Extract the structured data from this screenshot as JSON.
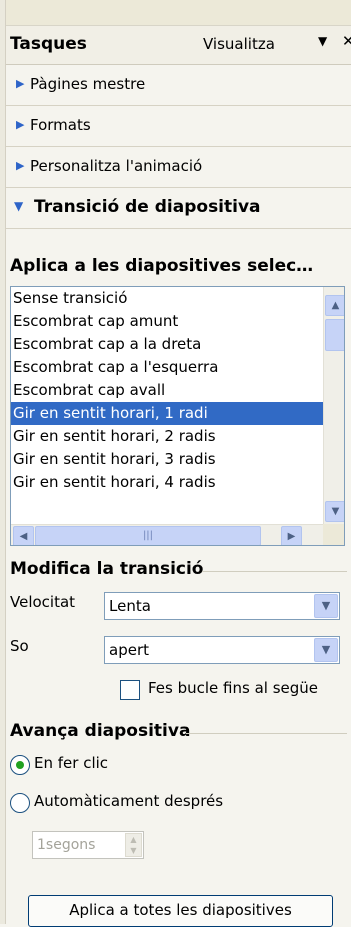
{
  "header": {
    "title": "Tasques",
    "view_label": "Visualitza",
    "dropdown_glyph": "▼",
    "close_glyph": "✕"
  },
  "sections": [
    {
      "label": "Pàgines mestre",
      "expanded": false,
      "icon": "triangle-right-icon"
    },
    {
      "label": "Formats",
      "expanded": false,
      "icon": "triangle-right-icon"
    },
    {
      "label": "Personalitza l'animació",
      "expanded": false,
      "icon": "triangle-right-icon"
    },
    {
      "label": "Transició de diapositiva",
      "expanded": true,
      "icon": "triangle-down-icon"
    }
  ],
  "transition": {
    "apply_to_label": "Aplica a les diapositives selec…",
    "items": [
      "Sense transició",
      "Escombrat cap amunt",
      "Escombrat cap a la dreta",
      "Escombrat cap a l'esquerra",
      "Escombrat cap avall",
      "Gir en sentit horari, 1 radi",
      "Gir en sentit horari, 2 radis",
      "Gir en sentit horari, 3 radis",
      "Gir en sentit horari, 4 radis"
    ],
    "selected_index": 5,
    "modify_label": "Modifica la transició",
    "speed_label": "Velocitat",
    "speed_value": "Lenta",
    "sound_label": "So",
    "sound_value": "apert",
    "loop_label": "Fes bucle fins al següe",
    "loop_checked": false
  },
  "advance": {
    "label": "Avança diapositiva",
    "on_click_label": "En fer clic",
    "on_click_selected": true,
    "auto_label": "Automàticament després",
    "auto_selected": false,
    "seconds_value": "1segons"
  },
  "apply_all_label": "Aplica a totes les diapositives",
  "colors": {
    "selection": "#316ac5",
    "radio_dot": "#21a121",
    "panel_bg": "#f5f4ee",
    "field_border": "#7f9db9"
  }
}
